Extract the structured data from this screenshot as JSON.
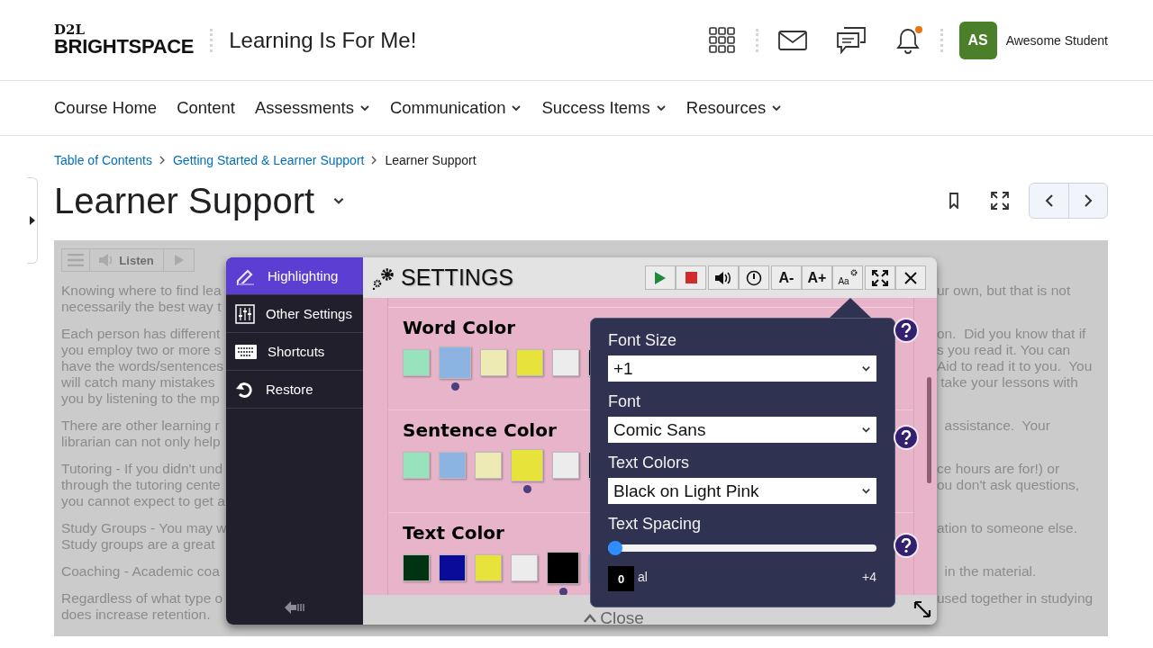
{
  "header": {
    "logo_top": "D2L",
    "logo_bottom": "BRIGHTSPACE",
    "course_title": "Learning Is For Me!",
    "notification_dot": true,
    "avatar_initials": "AS",
    "user_name": "Awesome Student"
  },
  "nav": [
    {
      "label": "Course Home",
      "has_menu": false
    },
    {
      "label": "Content",
      "has_menu": false
    },
    {
      "label": "Assessments",
      "has_menu": true
    },
    {
      "label": "Communication",
      "has_menu": true
    },
    {
      "label": "Success Items",
      "has_menu": true
    },
    {
      "label": "Resources",
      "has_menu": true
    }
  ],
  "breadcrumbs": [
    {
      "label": "Table of Contents",
      "link": true
    },
    {
      "label": "Getting Started & Learner Support",
      "link": true
    },
    {
      "label": "Learner Support",
      "link": false
    }
  ],
  "page_title": "Learner Support",
  "reader_toolbar": {
    "listen": "Listen"
  },
  "paragraphs": [
    {
      "lines": [
        {
          "left": "Knowing where to find lea",
          "right": "ur own, but that is not"
        },
        {
          "left": "necessarily the best way t"
        }
      ]
    },
    {
      "lines": [
        {
          "left": "Each person has different",
          "right": "on.  Did you know that if"
        },
        {
          "left": "you employ two or more s",
          "right": "s you read it. You can"
        },
        {
          "left": "have the words/sentences",
          "right": "Aid to read it to you.  You"
        },
        {
          "left": "will catch many mistakes",
          "right": " take your lessons with"
        },
        {
          "left": "you by listening to the mp"
        }
      ]
    },
    {
      "lines": [
        {
          "left": "There are other learning r",
          "right": "  assistance.  Your"
        },
        {
          "left": "librarian can not only help"
        }
      ]
    },
    {
      "lines": [
        {
          "left": "Tutoring - If you didn't und",
          "right": "ce hours are for!) or"
        },
        {
          "left": "through the tutoring cente",
          "right": "ou don't ask questions,"
        },
        {
          "left": "you cannot expect to get a"
        }
      ]
    },
    {
      "lines": [
        {
          "left": "Study Groups - You may w",
          "right": "ation to someone else."
        },
        {
          "left": "Study groups are a great"
        }
      ]
    },
    {
      "lines": [
        {
          "left": "Coaching - Academic coa",
          "right": "  in the material."
        }
      ]
    },
    {
      "lines": [
        {
          "left": "Regardless of what type o",
          "right": "used together in studying"
        },
        {
          "left": "does increase retention."
        }
      ]
    }
  ],
  "settings": {
    "title": "SETTINGS",
    "menu": [
      {
        "label": "Highlighting",
        "selected": true
      },
      {
        "label": "Other Settings",
        "selected": false
      },
      {
        "label": "Shortcuts",
        "selected": false
      },
      {
        "label": "Restore",
        "selected": false
      }
    ],
    "toolbar": {
      "decrease": "A-",
      "increase": "A+",
      "font_options": "Aa"
    },
    "sections": [
      {
        "title": "Word Color",
        "swatches": [
          {
            "color": "#98e3bd",
            "selected": false
          },
          {
            "color": "#8db3e2",
            "selected": true
          },
          {
            "color": "#eeeab4",
            "selected": false
          },
          {
            "color": "#e8e33a",
            "selected": false
          },
          {
            "color": "#ececec",
            "selected": false
          },
          {
            "color": "#000000",
            "selected": false
          }
        ]
      },
      {
        "title": "Sentence Color",
        "swatches": [
          {
            "color": "#98e3bd",
            "selected": false
          },
          {
            "color": "#8db3e2",
            "selected": false
          },
          {
            "color": "#eeeab4",
            "selected": false
          },
          {
            "color": "#e8e33a",
            "selected": true
          },
          {
            "color": "#ececec",
            "selected": false
          },
          {
            "color": "#000000",
            "selected": false
          }
        ]
      },
      {
        "title": "Text Color",
        "swatches": [
          {
            "color": "#003311",
            "selected": false
          },
          {
            "color": "#0b0b99",
            "selected": false
          },
          {
            "color": "#e8e33a",
            "selected": false
          },
          {
            "color": "#ececec",
            "selected": false
          },
          {
            "color": "#000000",
            "selected": true
          },
          {
            "color": "#8db3e2",
            "selected": false
          }
        ]
      }
    ],
    "close": "Close",
    "popup": {
      "fields": [
        {
          "label": "Font Size",
          "value": "+1"
        },
        {
          "label": "Font",
          "value": "Comic Sans"
        },
        {
          "label": "Text Colors",
          "value": "Black on Light Pink"
        }
      ],
      "spacing": {
        "label": "Text Spacing",
        "level": 0,
        "tooltip": "0",
        "min_label": "al",
        "max_label": "+4"
      }
    }
  }
}
